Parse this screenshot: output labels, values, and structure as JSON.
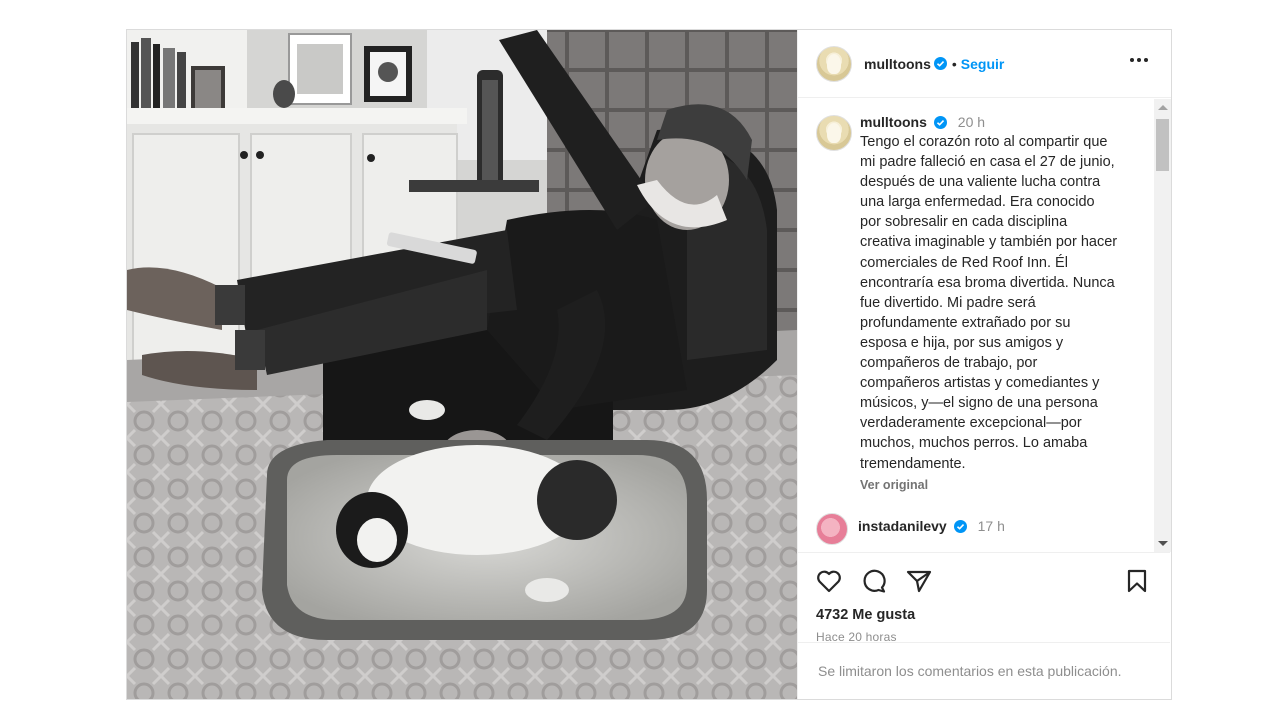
{
  "post": {
    "username": "mulltoons",
    "follow_label": "Seguir",
    "dot": "•",
    "caption": {
      "username": "mulltoons",
      "time": "20 h",
      "text": "Tengo el corazón roto al compartir que mi padre falleció en casa el 27 de junio, después de una valiente lucha contra una larga enfermedad. Era conocido por sobresalir en cada disciplina creativa imaginable y también por hacer comerciales de Red Roof Inn. Él encontraría esa broma divertida. Nunca fue divertido. Mi padre será profundamente extrañado por su esposa e hija, por sus amigos y compañeros de trabajo, por compañeros artistas y comediantes y músicos, y—el signo de una persona verdaderamente excepcional—por muchos, muchos perros. Lo amaba tremendamente.",
      "see_translation": "Ver original"
    },
    "reply": {
      "username": "instadanilevy",
      "time": "17 h"
    },
    "likes": "4732 Me gusta",
    "posted_ago": "Hace 20 horas",
    "comments_limited": "Se limitaron los comentarios en esta publicación."
  },
  "icons": {
    "verified": "verified-badge-icon",
    "more": "more-options-icon",
    "like": "heart-icon",
    "comment": "comment-icon",
    "share": "share-icon",
    "save": "bookmark-icon"
  },
  "colors": {
    "accent": "#0095f6",
    "text": "#262626",
    "muted": "#8e8e8e",
    "border": "#dbdbdb"
  }
}
